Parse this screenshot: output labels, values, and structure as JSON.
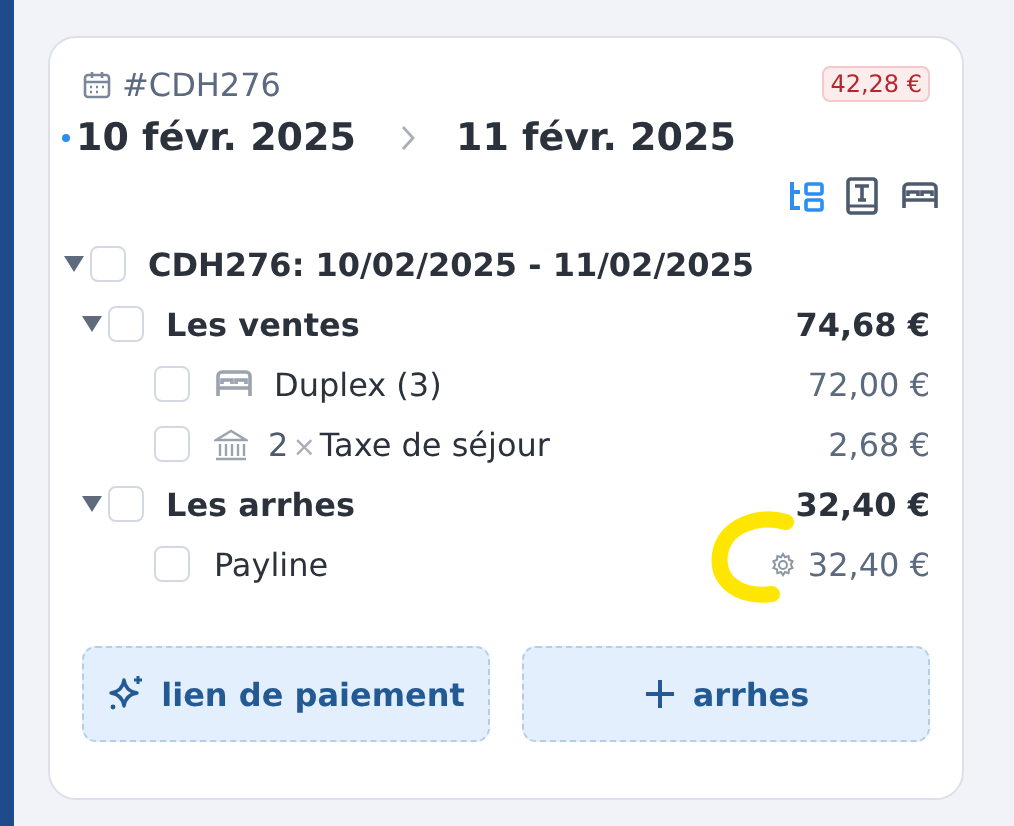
{
  "header": {
    "reference": "#CDH276",
    "balance": "42,28 €",
    "start_date": "10 févr. 2025",
    "end_date": "11 févr. 2025"
  },
  "view_icons": [
    {
      "kind": "tree",
      "selected": true
    },
    {
      "kind": "document",
      "selected": false
    },
    {
      "kind": "bed",
      "selected": false
    }
  ],
  "tree": [
    {
      "label": "CDH276: 10/02/2025 - 11/02/2025",
      "checked": false,
      "expanded": true,
      "children": [
        {
          "label": "Les ventes",
          "amount": "74,68 €",
          "checked": false,
          "expanded": true,
          "children": [
            {
              "kind": "room",
              "label": "Duplex (3)",
              "amount": "72,00 €",
              "checked": false
            },
            {
              "kind": "tax",
              "quantity": "2",
              "multiplier": "×",
              "label": "Taxe de séjour",
              "amount": "2,68 €",
              "checked": false
            }
          ]
        },
        {
          "label": "Les arrhes",
          "amount": "32,40 €",
          "checked": false,
          "expanded": true,
          "children": [
            {
              "kind": "payment",
              "label": "Payline",
              "amount": "32,40 €",
              "highlighted": true,
              "checked": false
            }
          ]
        }
      ]
    }
  ],
  "buttons": [
    {
      "kind": "sparkle",
      "label": "lien de paiement"
    },
    {
      "kind": "plus",
      "label": "arrhes"
    }
  ]
}
